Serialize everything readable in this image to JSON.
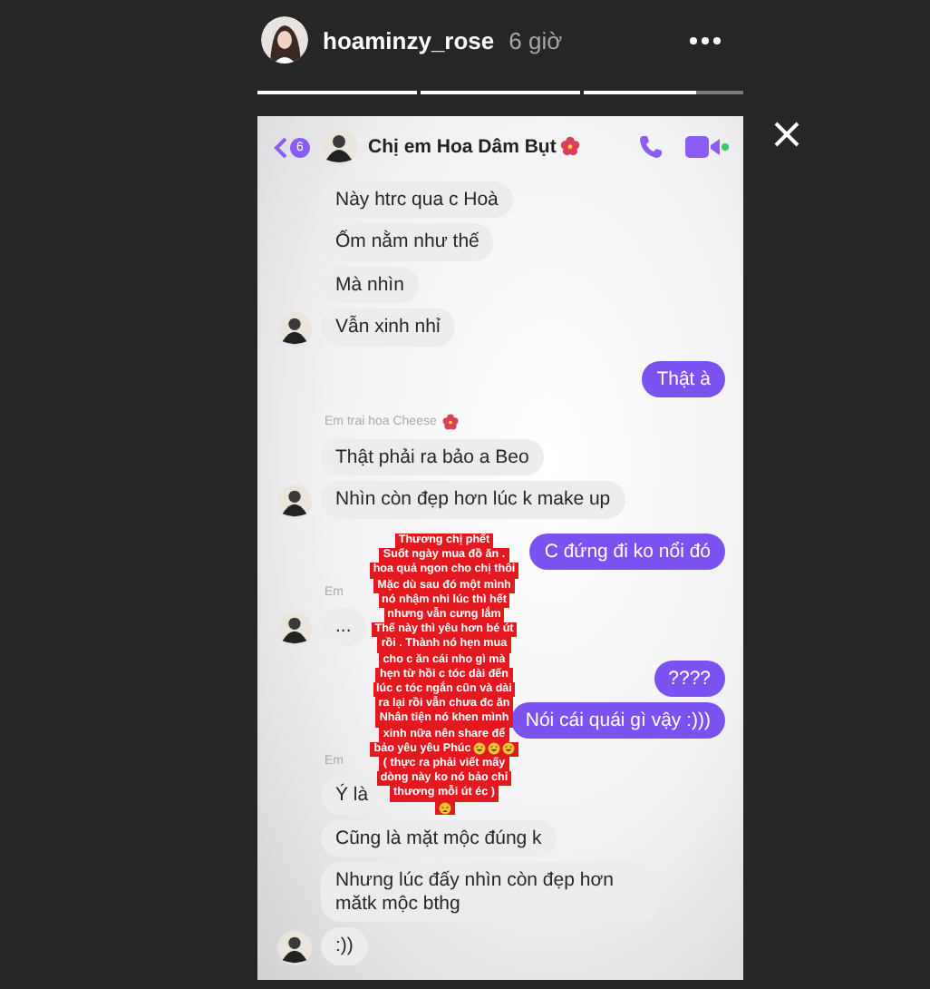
{
  "story": {
    "username": "hoaminzy_rose",
    "time": "6 giờ",
    "progress": [
      {
        "level": 1
      },
      {
        "level": 1
      },
      {
        "level": 0.7
      }
    ]
  },
  "chat": {
    "back_badge": "6",
    "title": "Chị em Hoa Dâm Bụt",
    "messages": [
      {
        "kind": "incoming",
        "text": "Này htrc qua c Hoà",
        "avatar": false
      },
      {
        "kind": "incoming",
        "text": "Ốm nằm như thế",
        "avatar": false
      },
      {
        "kind": "incoming",
        "text": "Mà nhìn",
        "avatar": false
      },
      {
        "kind": "incoming",
        "text": "Vẫn xinh nhỉ",
        "avatar": true
      },
      {
        "kind": "outgoing",
        "text": "Thật à"
      },
      {
        "kind": "flowersender",
        "text": "Em trai hoa Cheese"
      },
      {
        "kind": "incoming",
        "text": "Thật phải ra bảo a Beo",
        "avatar": false
      },
      {
        "kind": "incoming",
        "text": "Nhìn còn đẹp hơn lúc k make up",
        "avatar": true
      },
      {
        "kind": "outgoing",
        "text": "C đứng đi ko nổi đó"
      },
      {
        "kind": "sender",
        "text": "Em"
      },
      {
        "kind": "incoming",
        "text": "...",
        "avatar": true
      },
      {
        "kind": "outgoing",
        "text": "????"
      },
      {
        "kind": "outgoing",
        "text": "Nói cái quái gì vậy :)))"
      },
      {
        "kind": "sender",
        "text": "Em"
      },
      {
        "kind": "incoming",
        "text": "Ý là",
        "avatar": false
      },
      {
        "kind": "incoming",
        "text": "Cũng là mặt mộc đúng k",
        "avatar": false
      },
      {
        "kind": "incoming",
        "text": "Nhưng lúc đấy nhìn còn đẹp hơn mătk mộc bthg",
        "avatar": false
      },
      {
        "kind": "incoming",
        "text": ":))",
        "avatar": true
      }
    ]
  },
  "caption": [
    {
      "text": "Thương chị phết"
    },
    {
      "text": "Suốt ngày mua đồ ăn ."
    },
    {
      "text": "hoa quả ngon cho chị thôi"
    },
    {
      "text": "Mặc dù sau đó một mình"
    },
    {
      "text": "nó nhậm nhi lúc thì hết"
    },
    {
      "text": "nhưng vẫn cưng lắm"
    },
    {
      "text": "Thế này thì yêu hơn bé út"
    },
    {
      "text": "rồi . Thành nó hẹn mua"
    },
    {
      "text": "cho c ăn cái nho gì mà"
    },
    {
      "text": "hẹn từ hồi c tóc dài đến"
    },
    {
      "text": "lúc c tóc ngắn cũn và dài"
    },
    {
      "text": "ra lại rồi vẫn chưa đc ăn"
    },
    {
      "text": "Nhân tiện nó khen mình"
    },
    {
      "text": "xinh nữa nên share để"
    },
    {
      "kind": "laughing",
      "text": "bảo yêu yêu Phúc"
    },
    {
      "text": "( thực ra phải viết mấy"
    },
    {
      "text": "dòng này ko nó bảo chỉ"
    },
    {
      "text": "thương mỗi út éc )"
    },
    {
      "kind": "weary"
    }
  ]
}
